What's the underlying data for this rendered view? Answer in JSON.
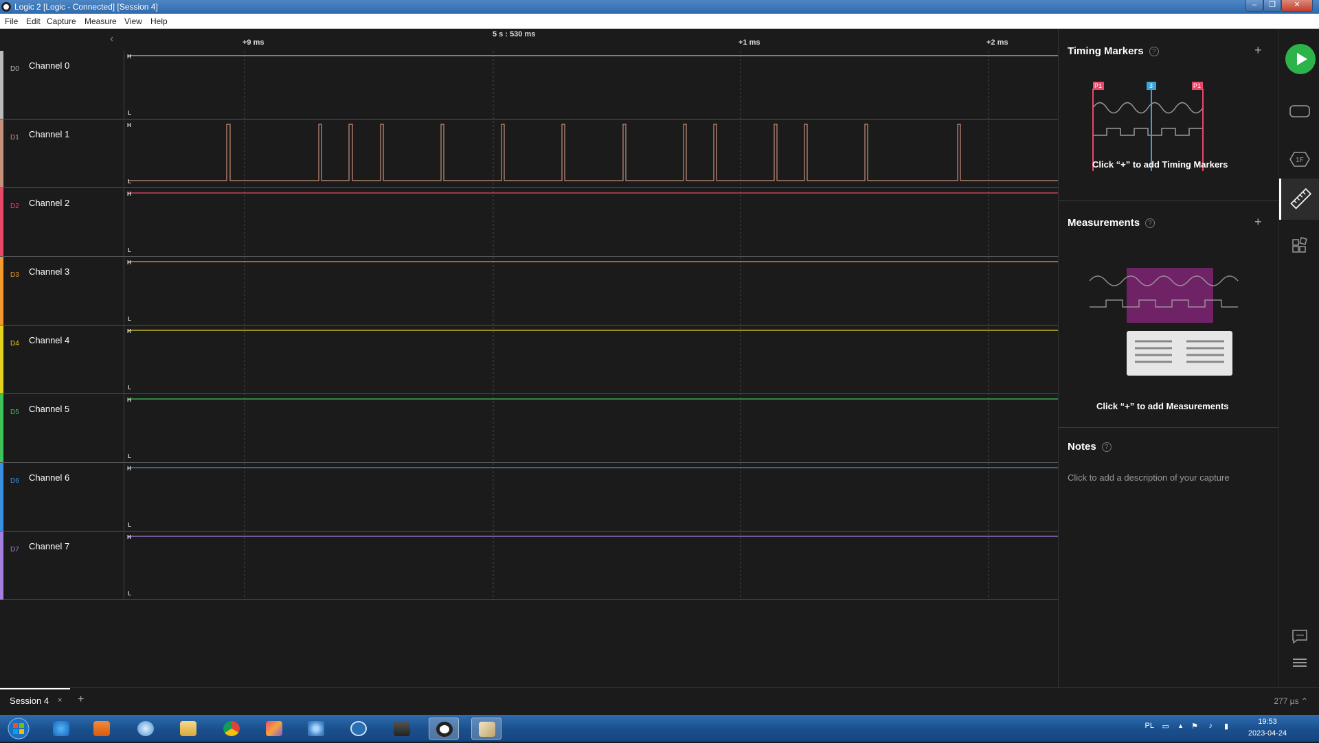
{
  "window": {
    "title": "Logic 2 [Logic - Connected] [Session 4]"
  },
  "menu": [
    "File",
    "Edit",
    "Capture",
    "Measure",
    "View",
    "Help"
  ],
  "timeline": {
    "center_label": "5 s : 530 ms",
    "ticks": [
      "+9 ms",
      "+1 ms",
      "+2 ms"
    ]
  },
  "channels": [
    {
      "tag": "D0",
      "name": "Channel 0",
      "color": "#bbbbbb"
    },
    {
      "tag": "D1",
      "name": "Channel 1",
      "color": "#c7907a"
    },
    {
      "tag": "D2",
      "name": "Channel 2",
      "color": "#e8486a"
    },
    {
      "tag": "D3",
      "name": "Channel 3",
      "color": "#f29a2f"
    },
    {
      "tag": "D4",
      "name": "Channel 4",
      "color": "#e3d21e"
    },
    {
      "tag": "D5",
      "name": "Channel 5",
      "color": "#3fc25a"
    },
    {
      "tag": "D6",
      "name": "Channel 6",
      "color": "#3b8fe0"
    },
    {
      "tag": "D7",
      "name": "Channel 7",
      "color": "#a47fe0"
    }
  ],
  "level_labels": {
    "high": "H",
    "low": "L"
  },
  "panel": {
    "timing_markers": {
      "title": "Timing Markers",
      "hint": "Click “+” to add Timing Markers",
      "marker_labels": [
        "P1",
        "3",
        "P1"
      ]
    },
    "measurements": {
      "title": "Measurements",
      "hint": "Click “+” to add Measurements"
    },
    "notes": {
      "title": "Notes",
      "hint": "Click to add a description of your capture"
    }
  },
  "bottom": {
    "session_tab": "Session 4",
    "close_glyph": "×",
    "add_glyph": "+",
    "zoom": "277 µs ⌃"
  },
  "taskbar": {
    "lang": "PL",
    "time": "19:53",
    "date": "2023-04-24"
  }
}
